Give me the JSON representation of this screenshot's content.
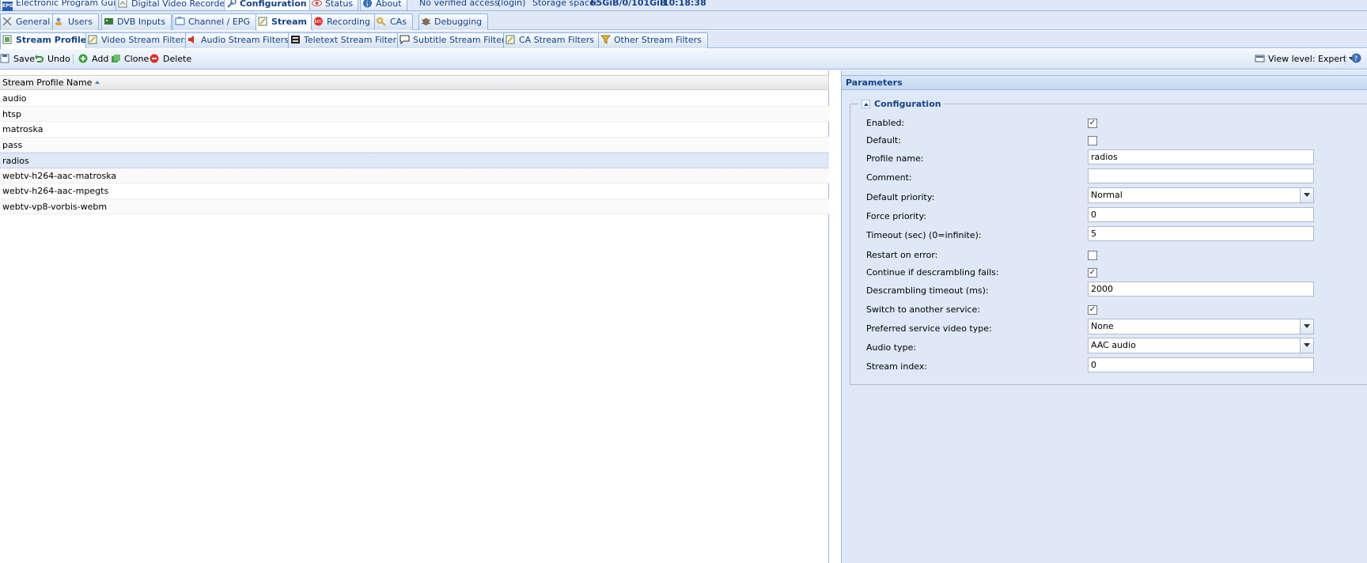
{
  "top_tabs": [
    {
      "label": "Electronic Program Guide",
      "icon": "epg-icon"
    },
    {
      "label": "Digital Video Recorder",
      "icon": "dvr-icon"
    },
    {
      "label": "Configuration",
      "icon": "wrench-icon",
      "active": true
    },
    {
      "label": "Status",
      "icon": "eye-icon"
    },
    {
      "label": "About",
      "icon": "info-icon"
    }
  ],
  "status": {
    "access": "No verified access",
    "login": "(login)",
    "storage_label": "Storage space:",
    "storage_value": "65GiB/0/101GiB",
    "time": "10:18:38"
  },
  "config_tabs": [
    {
      "label": "General",
      "icon": "tools-icon"
    },
    {
      "label": "Users",
      "icon": "users-icon"
    },
    {
      "label": "DVB Inputs",
      "icon": "tuner-icon"
    },
    {
      "label": "Channel / EPG",
      "icon": "tv-icon"
    },
    {
      "label": "Stream",
      "icon": "stream-icon",
      "active": true
    },
    {
      "label": "Recording",
      "icon": "rec-icon"
    },
    {
      "label": "CAs",
      "icon": "key-icon"
    },
    {
      "label": "Debugging",
      "icon": "bug-icon"
    }
  ],
  "stream_tabs": [
    {
      "label": "Stream Profiles",
      "icon": "stream-profiles-icon",
      "active": true
    },
    {
      "label": "Video Stream Filters",
      "icon": "video-filter-icon"
    },
    {
      "label": "Audio Stream Filters",
      "icon": "speaker-icon"
    },
    {
      "label": "Teletext Stream Filters",
      "icon": "teletext-icon"
    },
    {
      "label": "Subtitle Stream Filters",
      "icon": "subtitle-icon"
    },
    {
      "label": "CA Stream Filters",
      "icon": "ca-filter-icon"
    },
    {
      "label": "Other Stream Filters",
      "icon": "funnel-icon"
    }
  ],
  "toolbar": {
    "save": "Save",
    "undo": "Undo",
    "add": "Add",
    "clone": "Clone",
    "delete": "Delete",
    "view_level": "View level: Expert"
  },
  "grid": {
    "column": "Stream Profile Name",
    "rows": [
      "audio",
      "htsp",
      "matroska",
      "pass",
      "radios",
      "webtv-h264-aac-matroska",
      "webtv-h264-aac-mpegts",
      "webtv-vp8-vorbis-webm"
    ],
    "selected_index": 4
  },
  "params": {
    "title": "Parameters",
    "section": "Configuration",
    "fields": [
      {
        "label": "Enabled:",
        "type": "checkbox",
        "checked": true
      },
      {
        "label": "Default:",
        "type": "checkbox",
        "checked": false
      },
      {
        "label": "Profile name:",
        "type": "text",
        "value": "radios"
      },
      {
        "label": "Comment:",
        "type": "text",
        "value": ""
      },
      {
        "label": "Default priority:",
        "type": "select",
        "value": "Normal"
      },
      {
        "label": "Force priority:",
        "type": "text",
        "value": "0"
      },
      {
        "label": "Timeout (sec) (0=infinite):",
        "type": "text",
        "value": "5"
      },
      {
        "label": "Restart on error:",
        "type": "checkbox",
        "checked": false
      },
      {
        "label": "Continue if descrambling fails:",
        "type": "checkbox",
        "checked": true
      },
      {
        "label": "Descrambling timeout (ms):",
        "type": "text",
        "value": "2000"
      },
      {
        "label": "Switch to another service:",
        "type": "checkbox",
        "checked": true
      },
      {
        "label": "Preferred service video type:",
        "type": "select",
        "value": "None"
      },
      {
        "label": "Audio type:",
        "type": "select",
        "value": "AAC audio"
      },
      {
        "label": "Stream index:",
        "type": "text",
        "value": "0"
      }
    ]
  },
  "colors": {
    "accent": "#15428b",
    "panel_bg": "#dfe8f6",
    "border": "#99bbe8",
    "selected_row": "#dfe8f6"
  }
}
